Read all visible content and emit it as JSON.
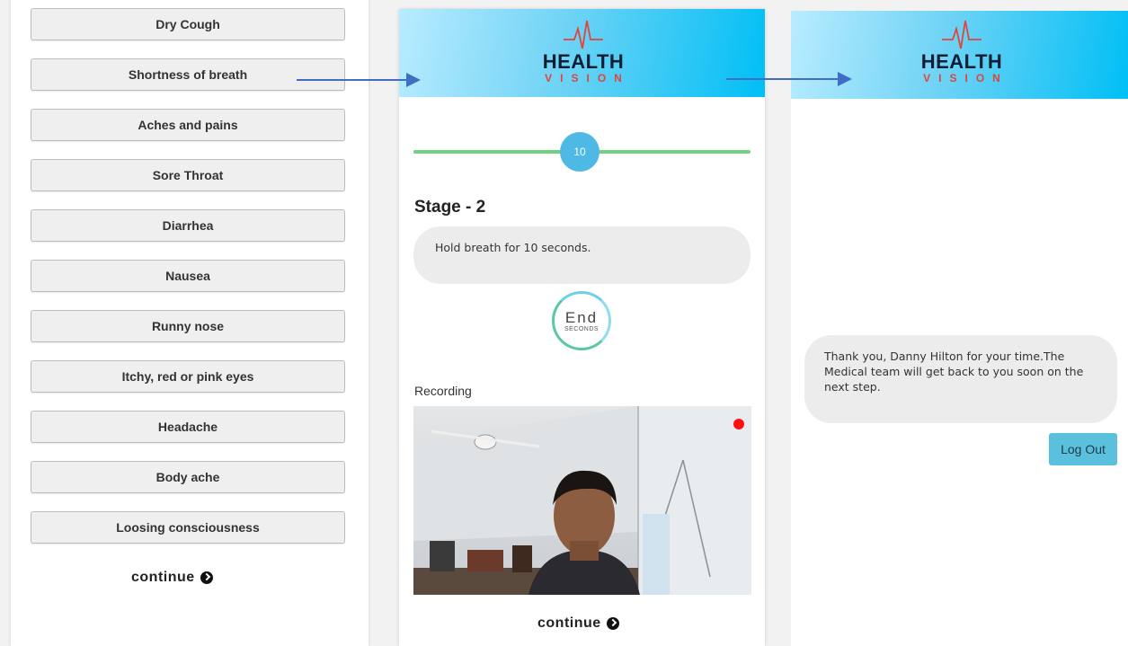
{
  "symptoms_screen": {
    "items": [
      {
        "label": "Dry Cough"
      },
      {
        "label": "Shortness of breath"
      },
      {
        "label": "Aches and pains"
      },
      {
        "label": "Sore Throat"
      },
      {
        "label": "Diarrhea"
      },
      {
        "label": "Nausea"
      },
      {
        "label": "Runny nose"
      },
      {
        "label": "Itchy, red or pink eyes"
      },
      {
        "label": "Headache"
      },
      {
        "label": "Body ache"
      },
      {
        "label": "Loosing consciousness"
      }
    ],
    "continue_label": "continue"
  },
  "recording_screen": {
    "logo": {
      "title": "HEALTH",
      "subtitle": "VISION"
    },
    "timer_slider_value": "10",
    "stage_title": "Stage - 2",
    "instruction": "Hold breath for 10 seconds.",
    "timer": {
      "main": "End",
      "unit": "SECONDS"
    },
    "recording_label": "Recording",
    "continue_label": "continue"
  },
  "thankyou_screen": {
    "logo": {
      "title": "HEALTH",
      "subtitle": "VISION"
    },
    "message": "Thank you, Danny Hilton for your time.The Medical team will get back to you soon on the next step.",
    "logout_label": "Log Out"
  },
  "colors": {
    "banner_start": "#b9ecff",
    "banner_end": "#00bff5",
    "slider_track": "#72d07f",
    "slider_knob": "#4fb9e6",
    "logout_button": "#5bc0de",
    "recording_dot": "#ff1010",
    "flow_arrow": "#3f6fc4"
  },
  "icons": [
    "chevron-circle-right-icon",
    "heartbeat-icon",
    "recording-dot-icon",
    "flow-arrow-icon"
  ]
}
